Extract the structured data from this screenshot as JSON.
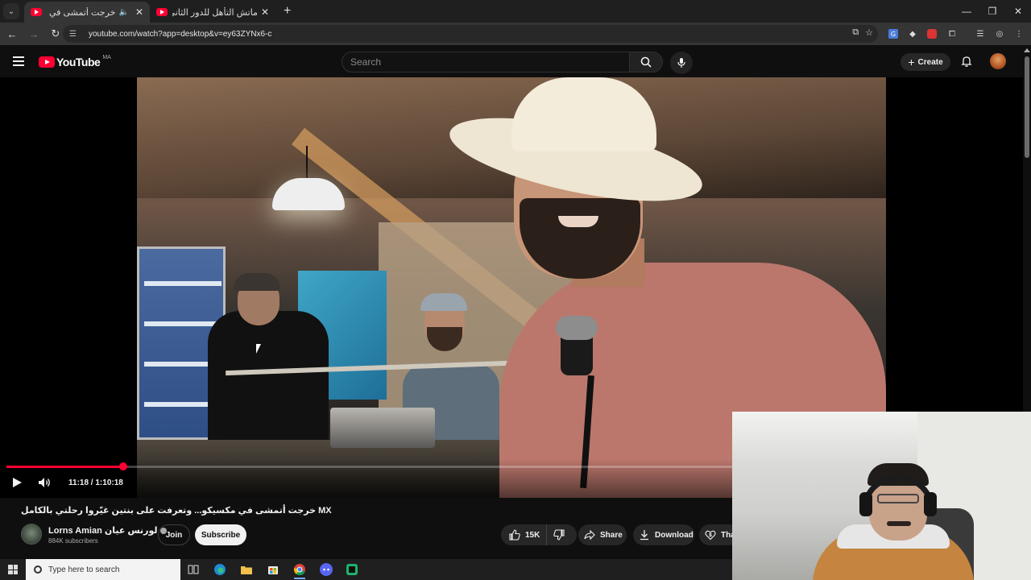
{
  "browser": {
    "tabs": [
      {
        "title": "خرجت أتمشى في مكسيكو...",
        "active": true,
        "audio": true
      },
      {
        "title": "ماتش التأهل للدور الثاني؟ النشكـ",
        "active": false,
        "audio": false
      }
    ],
    "new_tab_icon": "plus-icon",
    "url": "youtube.com/watch?app=desktop&v=ey63ZYNx6-c",
    "window_controls": [
      "minimize-icon",
      "restore-icon",
      "close-icon"
    ]
  },
  "masthead": {
    "logo_text": "YouTube",
    "region": "MA",
    "search_placeholder": "Search",
    "create_label": "Create"
  },
  "player": {
    "time": "11:18 / 1:10:18",
    "progress_fraction": 0.1609,
    "paused": true
  },
  "video": {
    "title": "خرجت أتمشى في مكسيكو... وتعرفت على بنتين غيّروا رحلتي بالكامل MX",
    "channel_name": "Lorns Amian لورنس عيان",
    "subscribers": "884K subscribers",
    "join_label": "Join",
    "subscribe_label": "Subscribe",
    "likes": "15K",
    "share_label": "Share",
    "download_label": "Download",
    "thanks_label": "Tha"
  },
  "taskbar": {
    "search_placeholder": "Type here to search",
    "icons": [
      "task-view-icon",
      "edge-icon",
      "file-explorer-icon",
      "store-icon",
      "chrome-icon",
      "discord-icon",
      "app-icon"
    ]
  },
  "colors": {
    "accent_red": "#ff0033",
    "background": "#0f0f0f"
  }
}
